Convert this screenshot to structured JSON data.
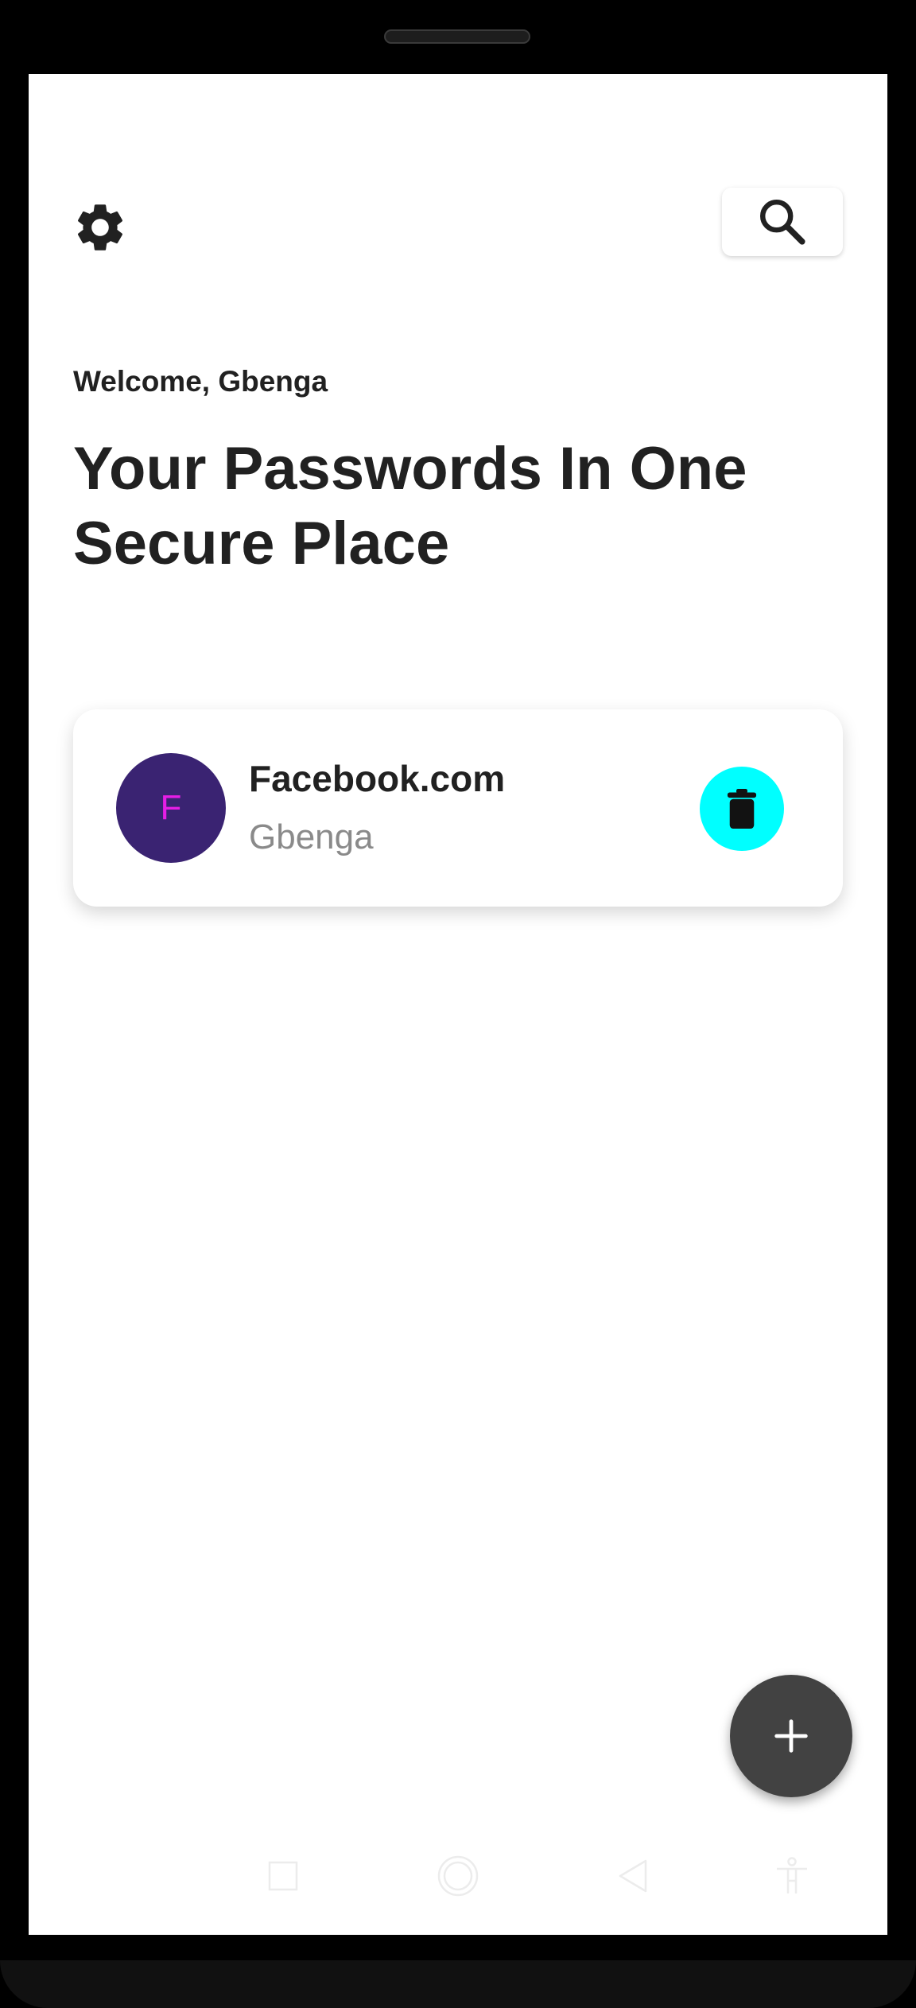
{
  "header": {
    "settings_icon": "gear-icon",
    "search_icon": "search-icon"
  },
  "main": {
    "welcome": "Welcome, Gbenga",
    "headline_line1": "Your Passwords In One",
    "headline_line2": "Secure Place"
  },
  "entries": [
    {
      "initial": "F",
      "site": "Facebook.com",
      "username": "Gbenga",
      "avatar_color": "#3a2372",
      "initial_color": "#e61ee6",
      "delete_icon": "trash-icon",
      "delete_color": "#00ffff"
    }
  ],
  "fab": {
    "icon": "plus-icon",
    "color": "#424242"
  },
  "navbar": {
    "items": [
      "recents-icon",
      "home-icon",
      "back-icon",
      "accessibility-icon"
    ]
  }
}
